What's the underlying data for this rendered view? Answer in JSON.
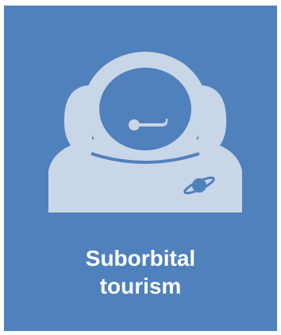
{
  "tile": {
    "icon": "astronaut-helmet-icon",
    "title_line1": "Suborbital",
    "title_line2": "tourism",
    "background_color": "#4f81bd",
    "icon_color": "#c9d6e8",
    "text_color": "#ffffff"
  }
}
